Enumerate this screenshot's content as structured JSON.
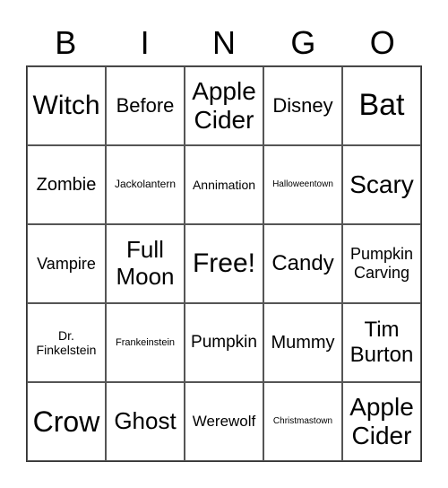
{
  "header": [
    "B",
    "I",
    "N",
    "G",
    "O"
  ],
  "cells": [
    "Witch",
    "Before",
    "Apple Cider",
    "Disney",
    "Bat",
    "Zombie",
    "Jackolantern",
    "Annimation",
    "Halloweentown",
    "Scary",
    "Vampire",
    "Full Moon",
    "Free!",
    "Candy",
    "Pumpkin Carving",
    "Dr. Finkelstein",
    "Frankeinstein",
    "Pumpkin",
    "Mummy",
    "Tim Burton",
    "Crow",
    "Ghost",
    "Werewolf",
    "Christmastown",
    "Apple Cider"
  ]
}
